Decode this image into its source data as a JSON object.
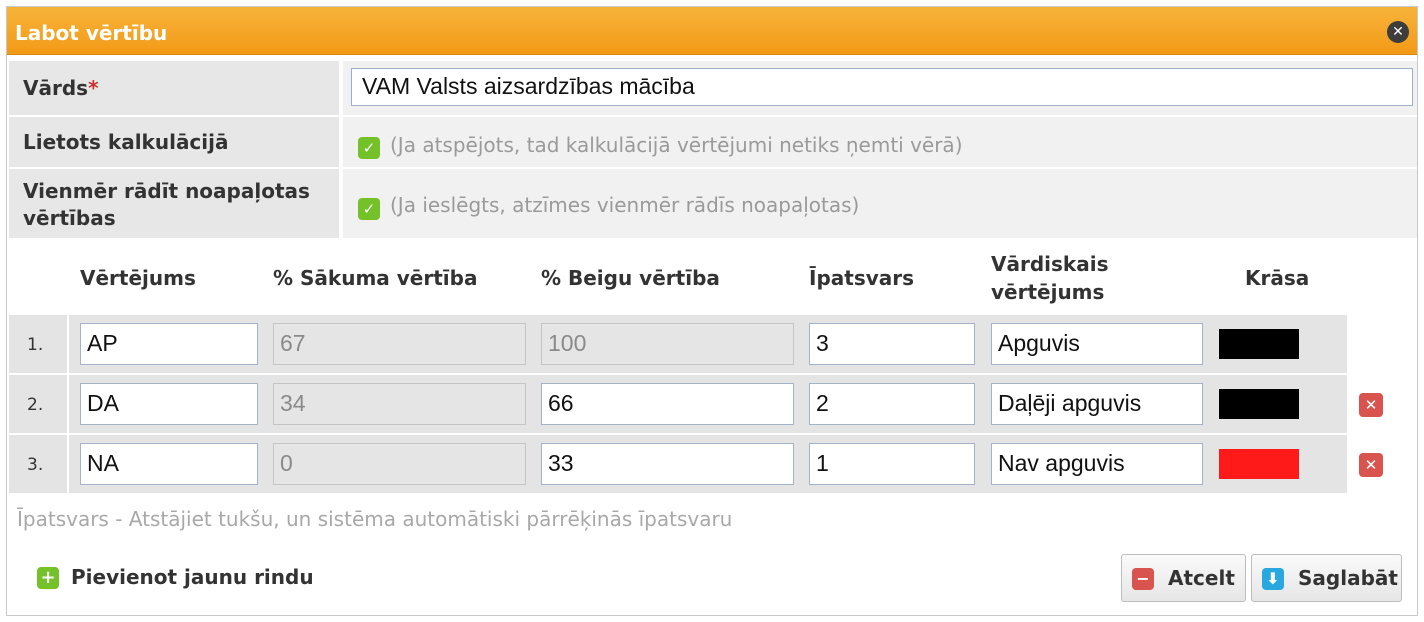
{
  "dialog": {
    "title": "Labot vērtību",
    "close_icon": "close-icon"
  },
  "form": {
    "name": {
      "label": "Vārds",
      "required_mark": "*",
      "value": "VAM Valsts aizsardzības mācība"
    },
    "used_in_calc": {
      "label": "Lietots kalkulācijā",
      "checked": true,
      "hint": "(Ja atspējots, tad kalkulācijā vērtējumi netiks ņemti vērā)"
    },
    "always_rounded": {
      "label_line1": "Vienmēr rādīt noapaļotas",
      "label_line2": "vērtības",
      "checked": true,
      "hint": "(Ja ieslēgts, atzīmes vienmēr rādīs noapaļotas)"
    }
  },
  "table": {
    "headers": {
      "grade": "Vērtējums",
      "start": "% Sākuma vērtība",
      "end": "% Beigu vērtība",
      "weight": "Īpatsvars",
      "verbal_line1": "Vārdiskais",
      "verbal_line2": "vērtējums",
      "color": "Krāsa"
    },
    "rows": [
      {
        "num": "1.",
        "grade": "AP",
        "start": "67",
        "end": "100",
        "weight": "3",
        "verbal": "Apguvis",
        "color": "#000000",
        "deletable": false
      },
      {
        "num": "2.",
        "grade": "DA",
        "start": "34",
        "end": "66",
        "weight": "2",
        "verbal": "Daļēji apguvis",
        "color": "#000000",
        "deletable": true
      },
      {
        "num": "3.",
        "grade": "NA",
        "start": "0",
        "end": "33",
        "weight": "1",
        "verbal": "Nav apguvis",
        "color": "#ff1a1a",
        "deletable": true
      }
    ],
    "footnote": "Īpatsvars - Atstājiet tukšu, un sistēma automātiski pārrēķinās īpatsvaru"
  },
  "actions": {
    "add_row": "Pievienot jaunu rindu",
    "cancel": "Atcelt",
    "save": "Saglabāt"
  },
  "colors": {
    "title_bar": "#f39a17",
    "check_green": "#74c12a",
    "delete_red": "#d9534f",
    "save_blue": "#29a8e0"
  }
}
